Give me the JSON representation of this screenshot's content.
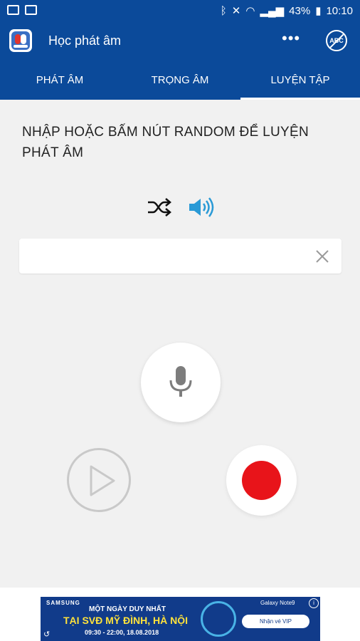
{
  "status_bar": {
    "battery": "43%",
    "time": "10:10"
  },
  "app_bar": {
    "title": "Học phát âm",
    "more_icon": "more-icon",
    "abc_label": "ABC"
  },
  "tabs": [
    {
      "label": "PHÁT ÂM"
    },
    {
      "label": "TRỌNG ÂM"
    },
    {
      "label": "LUYỆN TẬP"
    }
  ],
  "active_tab": 2,
  "prompt": "NHẬP HOẶC BẤM NÚT RANDOM ĐỂ LUYỆN PHÁT ÂM",
  "input": {
    "value": "",
    "placeholder": ""
  },
  "ad": {
    "brand": "SAMSUNG",
    "line1": "MỘT NGÀY DUY NHẤT",
    "line2": "TẠI SVĐ MỸ ĐÌNH, HÀ NỘI",
    "line3": "09:30 - 22:00, 18.08.2018",
    "product": "Galaxy Note9",
    "cta": "Nhận vé VIP"
  },
  "colors": {
    "primary": "#0b4a9a",
    "accent": "#2a9ad6",
    "record": "#e8141a"
  }
}
